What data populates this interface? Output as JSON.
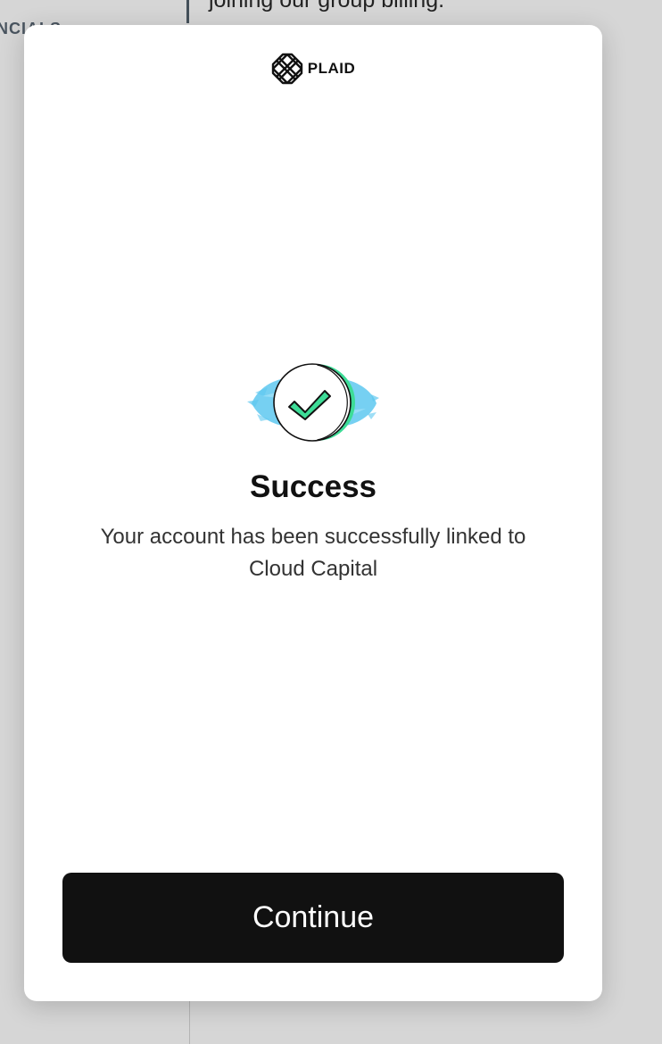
{
  "background": {
    "left_text": "NCIALS",
    "top_text": "joining our group billing."
  },
  "modal": {
    "brand": {
      "name": "PLAID",
      "logo_icon": "plaid-logo-icon"
    },
    "illustration_icon": "success-checkmark-icon",
    "title": "Success",
    "message": "Your account has been successfully linked to Cloud Capital",
    "continue_label": "Continue"
  },
  "colors": {
    "button_bg": "#111111",
    "check_accent": "#3ddc97",
    "splash_accent": "#5ec8f0"
  }
}
